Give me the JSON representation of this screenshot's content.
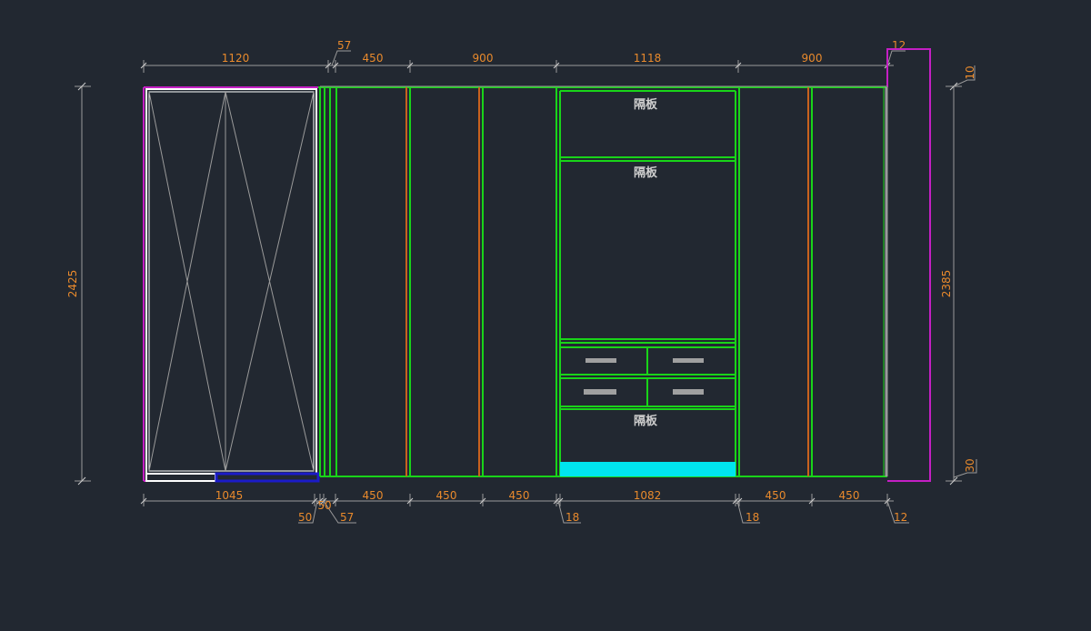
{
  "drawing": {
    "background": "#222831",
    "colors": {
      "dimension_text": "#e98a2c",
      "dimension_line": "#9a9a9a",
      "panel": "#19d419",
      "divider": "#c9621e",
      "door_outline": "#ffffff",
      "boundary": "#c41fc4",
      "floor_strip": "#1b1bc8",
      "base_fill": "#00e5ee",
      "handle": "#a0a0a0"
    },
    "top_dimensions": [
      "1120",
      "57",
      "450",
      "900",
      "1118",
      "900",
      "12"
    ],
    "bottom_dimensions": [
      "1045",
      "50",
      "57",
      "450",
      "450",
      "450",
      "1082",
      "18",
      "18",
      "450",
      "450",
      "12",
      "50"
    ],
    "left_dimension": "2425",
    "right_dimensions": [
      "10",
      "2385",
      "30"
    ],
    "compartment_labels": [
      "隔板",
      "隔板",
      "隔板"
    ]
  }
}
